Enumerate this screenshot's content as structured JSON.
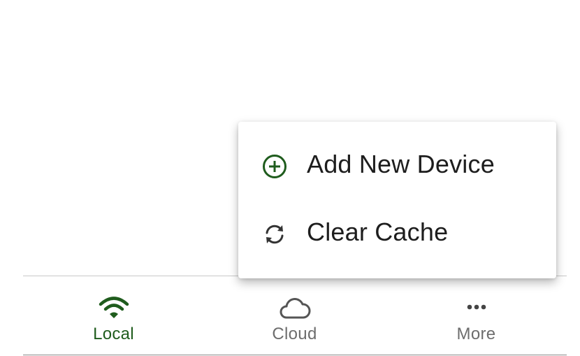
{
  "menu": {
    "items": [
      {
        "label": "Add New Device",
        "icon": "add-circle-icon",
        "icon_color": "#1f5c1d"
      },
      {
        "label": "Clear Cache",
        "icon": "refresh-icon",
        "icon_color": "#333333"
      }
    ]
  },
  "bottom_nav": {
    "items": [
      {
        "label": "Local",
        "icon": "wifi-icon",
        "active": true
      },
      {
        "label": "Cloud",
        "icon": "cloud-icon",
        "active": false
      },
      {
        "label": "More",
        "icon": "more-horizontal-icon",
        "active": false
      }
    ],
    "active_color": "#1f5c1d",
    "inactive_color": "#6d6d6d"
  }
}
